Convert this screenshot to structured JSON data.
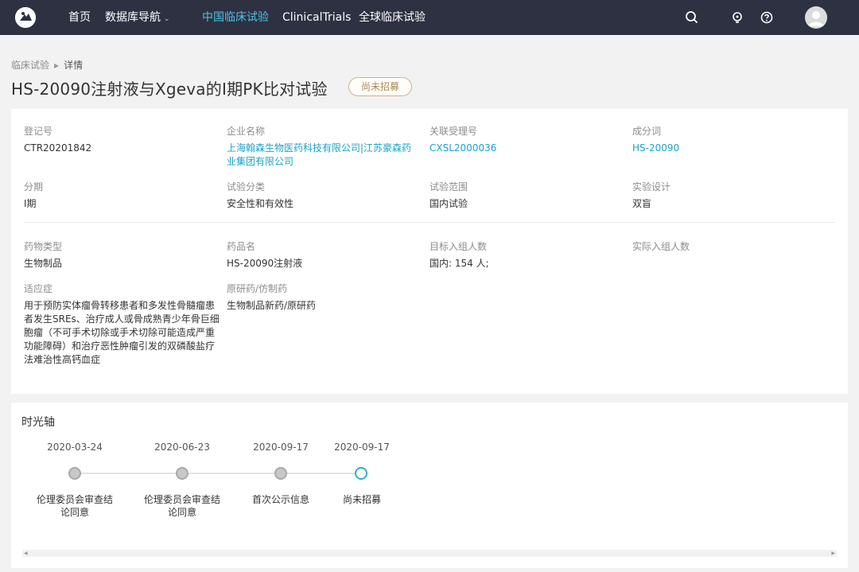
{
  "nav": {
    "items": [
      {
        "label": "首页"
      },
      {
        "label": "数据库导航"
      },
      {
        "label": "中国临床试验"
      },
      {
        "label": "ClinicalTrials"
      },
      {
        "label": "全球临床试验"
      }
    ],
    "active_color": "#4fc3e0",
    "bg_color": "#2d3142",
    "icons": [
      "search-icon",
      "lightbulb-icon",
      "help-icon",
      "user-avatar-icon"
    ]
  },
  "breadcrumb": {
    "parent": "临床试验",
    "current": "详情"
  },
  "page": {
    "title": "HS-20090注射液与Xgeva的I期PK比对试验",
    "status": "尚未招募"
  },
  "details": {
    "reg_no": {
      "label": "登记号",
      "value": "CTR20201842"
    },
    "company": {
      "label": "企业名称",
      "value": "上海翰森生物医药科技有限公司|江苏豪森药业集团有限公司"
    },
    "accept_no": {
      "label": "关联受理号",
      "value": "CXSL2000036"
    },
    "ingredient": {
      "label": "成分词",
      "value": "HS-20090"
    },
    "phase": {
      "label": "分期",
      "value": "I期"
    },
    "category": {
      "label": "试验分类",
      "value": "安全性和有效性"
    },
    "scope": {
      "label": "试验范围",
      "value": "国内试验"
    },
    "design": {
      "label": "实验设计",
      "value": "双盲"
    },
    "drug_type": {
      "label": "药物类型",
      "value": "生物制品"
    },
    "drug_name": {
      "label": "药品名",
      "value": "HS-20090注射液"
    },
    "target_enroll": {
      "label": "目标入组人数",
      "value": "国内: 154 人;"
    },
    "actual_enroll": {
      "label": "实际入组人数",
      "value": ""
    },
    "indication": {
      "label": "适应症",
      "value": "用于预防实体瘤骨转移患者和多发性骨髓瘤患者发生SREs、治疗成人或骨成熟青少年骨巨细胞瘤（不可手术切除或手术切除可能造成严重功能障碍）和治疗恶性肿瘤引发的双磷酸盐疗法难治性高钙血症"
    },
    "original": {
      "label": "原研药/仿制药",
      "value": "生物制品新药/原研药"
    }
  },
  "timeline": {
    "title": "时光轴",
    "events": [
      {
        "date": "2020-03-24",
        "label": "伦理委员会审查结论同意",
        "current": false
      },
      {
        "date": "2020-06-23",
        "label": "伦理委员会审查结论同意",
        "current": false
      },
      {
        "date": "2020-09-17",
        "label": "首次公示信息",
        "current": false
      },
      {
        "date": "2020-09-17",
        "label": "尚未招募",
        "current": true
      }
    ]
  }
}
